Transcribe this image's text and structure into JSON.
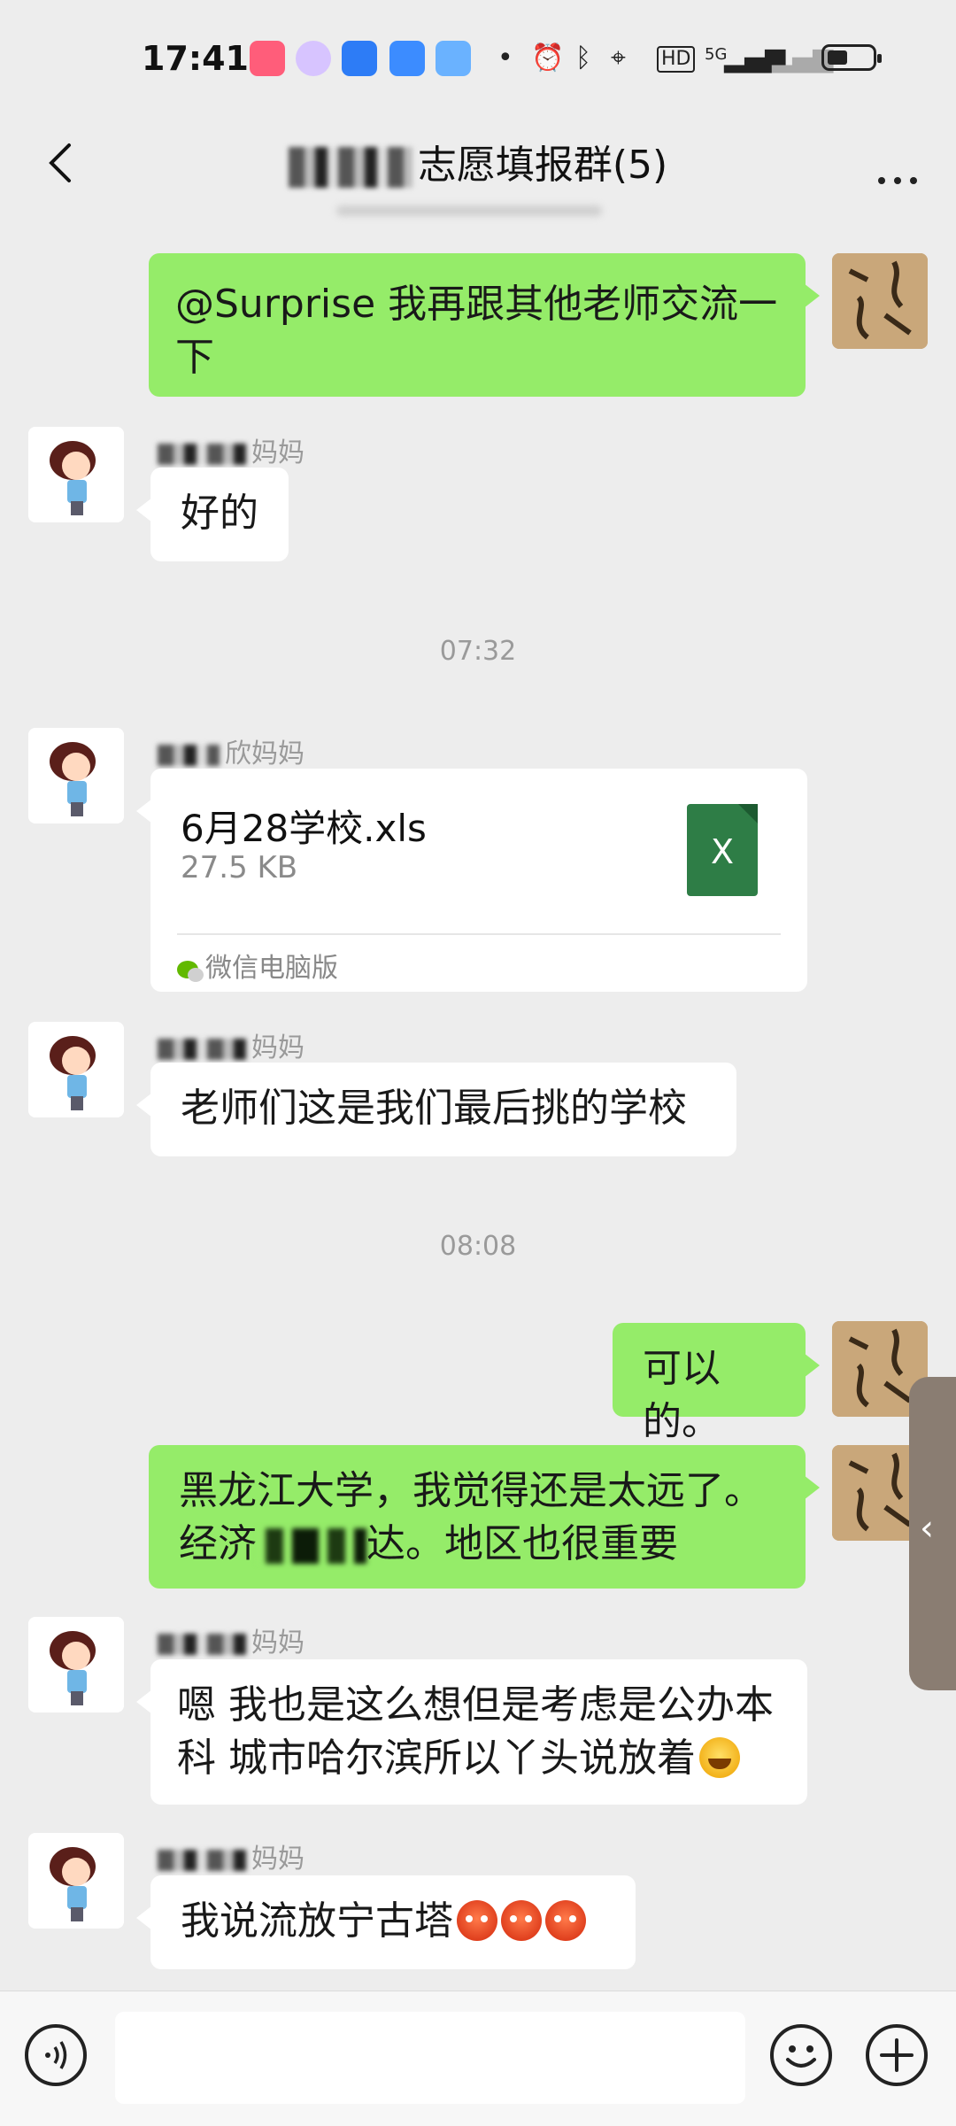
{
  "status_bar": {
    "time": "17:41",
    "net_badge": "5G",
    "hd_badge": "HD"
  },
  "nav": {
    "title_suffix": "志愿填报群(5)"
  },
  "messages": [
    {
      "kind": "text",
      "side": "mine",
      "text": "@Surprise  我再跟其他老师交流一下"
    },
    {
      "kind": "text",
      "side": "other",
      "sender_suffix": "妈妈",
      "text": "好的"
    },
    {
      "kind": "time",
      "text": "07:32"
    },
    {
      "kind": "file",
      "side": "other",
      "sender_suffix": "欣妈妈",
      "file_name": "6月28学校.xls",
      "file_size": "27.5 KB",
      "file_icon_letter": "X",
      "source": "微信电脑版"
    },
    {
      "kind": "text",
      "side": "other",
      "sender_suffix": "妈妈",
      "text": "老师们这是我们最后挑的学校"
    },
    {
      "kind": "time",
      "text": "08:08"
    },
    {
      "kind": "text",
      "side": "mine",
      "text": "可以的。"
    },
    {
      "kind": "text",
      "side": "mine",
      "text_line1": "黑龙江大学，我觉得还是太远了。",
      "text_line2_prefix": "经济",
      "text_line2_suffix": "达。地区也很重要"
    },
    {
      "kind": "text",
      "side": "other",
      "sender_suffix": "妈妈",
      "text": "嗯 我也是这么想但是考虑是公办本科 城市哈尔滨所以丫头说放着"
    },
    {
      "kind": "text",
      "side": "other",
      "sender_suffix": "妈妈",
      "text": "我说流放宁古塔"
    }
  ],
  "icons": {
    "back": "chevron-left-icon",
    "more": "more-icon",
    "voice": "voice-icon",
    "emoji": "emoji-icon",
    "plus": "plus-icon",
    "side_handle": "chevron-left-icon"
  },
  "input": {
    "value": "",
    "placeholder": ""
  },
  "colors": {
    "mine_bubble": "#95ec69",
    "other_bubble": "#ffffff",
    "background": "#ededed"
  }
}
